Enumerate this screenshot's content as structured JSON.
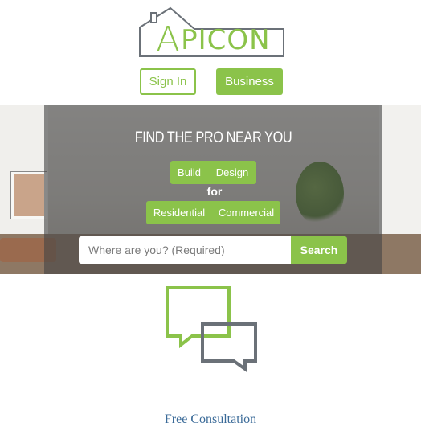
{
  "logo": {
    "first_letter": "A",
    "rest": "PICON",
    "brand_color": "#8bc34a",
    "icon": "house-outline-icon"
  },
  "header": {
    "signin_label": "Sign In",
    "business_label": "Business"
  },
  "hero": {
    "title": "FIND THE PRO NEAR YOU",
    "service_types": [
      "Build",
      "Design"
    ],
    "connector": "for",
    "property_types": [
      "Residential",
      "Commercial"
    ],
    "search": {
      "placeholder": "Where are you? (Required)",
      "value": "",
      "button_label": "Search"
    }
  },
  "feature": {
    "icon": "chat-bubbles-icon",
    "label": "Free Consultation",
    "colors": {
      "primary": "#8bc34a",
      "secondary": "#6b7178"
    }
  }
}
